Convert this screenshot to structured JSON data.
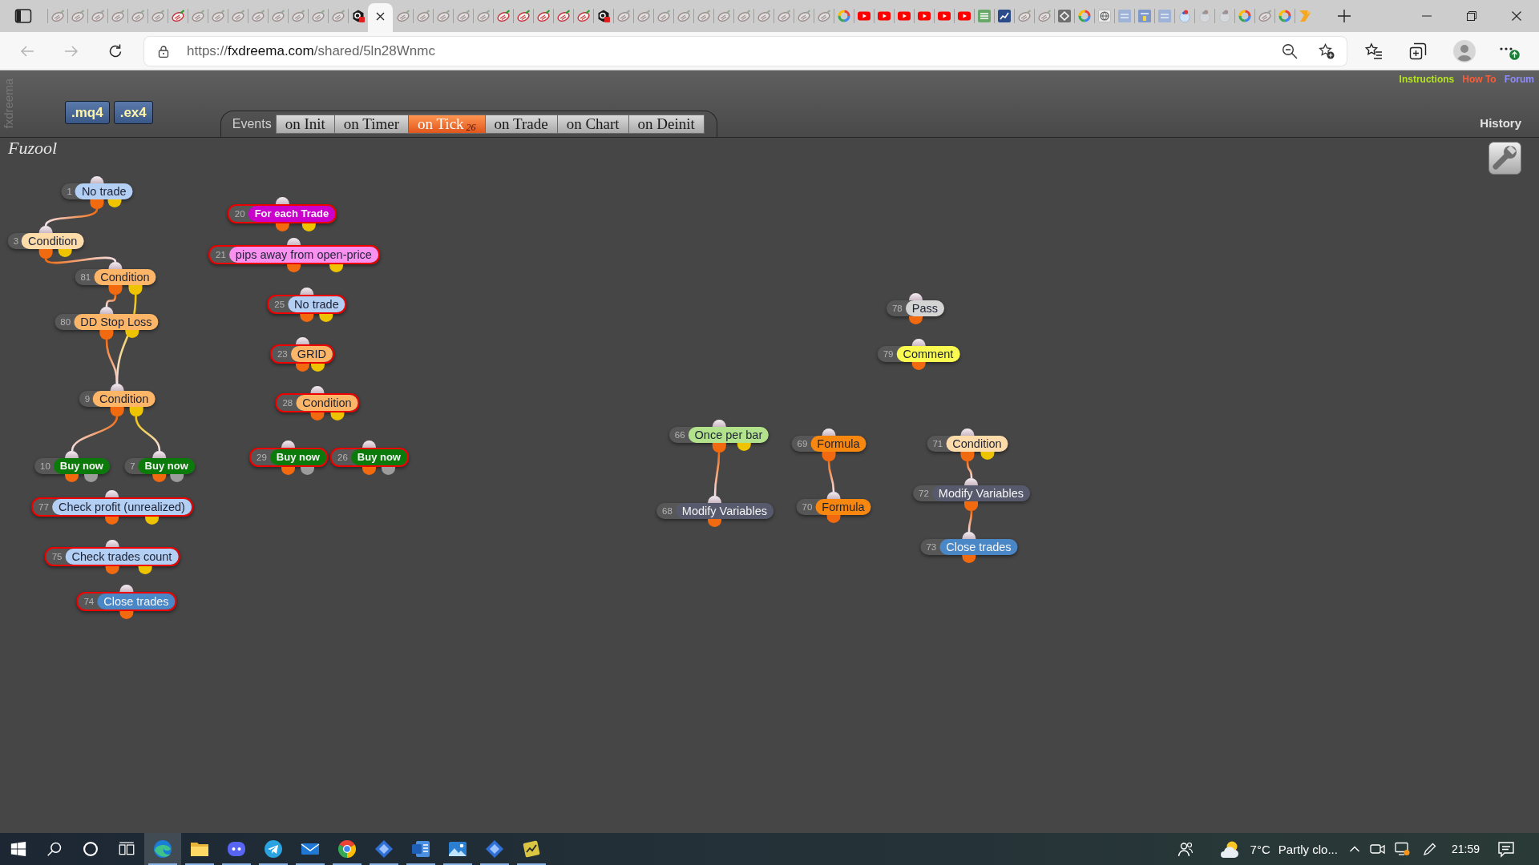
{
  "browser": {
    "tabs": [
      {
        "kind": "fxdreema",
        "sleeping": true,
        "selected": false
      },
      {
        "kind": "fxdreema",
        "sleeping": true,
        "selected": false
      },
      {
        "kind": "fxdreema",
        "sleeping": true,
        "selected": false
      },
      {
        "kind": "fxdreema",
        "sleeping": true,
        "selected": false
      },
      {
        "kind": "fxdreema",
        "sleeping": true,
        "selected": false
      },
      {
        "kind": "fxdreema",
        "sleeping": true,
        "selected": false
      },
      {
        "kind": "fxdreema",
        "sleeping": false,
        "selected": false
      },
      {
        "kind": "fxdreema",
        "sleeping": true,
        "selected": false
      },
      {
        "kind": "fxdreema",
        "sleeping": true,
        "selected": false
      },
      {
        "kind": "fxdreema",
        "sleeping": true,
        "selected": false
      },
      {
        "kind": "fxdreema",
        "sleeping": true,
        "selected": false
      },
      {
        "kind": "fxdreema",
        "sleeping": true,
        "selected": false
      },
      {
        "kind": "fxdreema",
        "sleeping": true,
        "selected": false
      },
      {
        "kind": "fxdreema",
        "sleeping": true,
        "selected": false
      },
      {
        "kind": "fxdreema",
        "sleeping": true,
        "selected": false
      },
      {
        "kind": "hexagon",
        "sleeping": false,
        "selected": false
      },
      {
        "sleeping": false,
        "selected": true
      },
      {
        "kind": "fxdreema",
        "sleeping": true,
        "selected": false
      },
      {
        "kind": "fxdreema",
        "sleeping": true,
        "selected": false
      },
      {
        "kind": "fxdreema",
        "sleeping": true,
        "selected": false
      },
      {
        "kind": "fxdreema",
        "sleeping": true,
        "selected": false
      },
      {
        "kind": "fxdreema",
        "sleeping": true,
        "selected": false
      },
      {
        "kind": "fxdreema",
        "sleeping": false,
        "selected": false
      },
      {
        "kind": "fxdreema",
        "sleeping": false,
        "selected": false
      },
      {
        "kind": "fxdreema",
        "sleeping": false,
        "selected": false
      },
      {
        "kind": "fxdreema",
        "sleeping": false,
        "selected": false
      },
      {
        "kind": "fxdreema",
        "sleeping": false,
        "selected": false
      },
      {
        "kind": "hexagon",
        "sleeping": false,
        "selected": false
      },
      {
        "kind": "fxdreema",
        "sleeping": true,
        "selected": false
      },
      {
        "kind": "fxdreema",
        "sleeping": true,
        "selected": false
      },
      {
        "kind": "fxdreema",
        "sleeping": true,
        "selected": false
      },
      {
        "kind": "fxdreema",
        "sleeping": true,
        "selected": false
      },
      {
        "kind": "fxdreema",
        "sleeping": true,
        "selected": false
      },
      {
        "kind": "fxdreema",
        "sleeping": true,
        "selected": false
      },
      {
        "kind": "fxdreema",
        "sleeping": true,
        "selected": false
      },
      {
        "kind": "fxdreema",
        "sleeping": true,
        "selected": false
      },
      {
        "kind": "fxdreema",
        "sleeping": true,
        "selected": false
      },
      {
        "kind": "fxdreema",
        "sleeping": true,
        "selected": false
      },
      {
        "kind": "fxdreema",
        "sleeping": true,
        "selected": false
      },
      {
        "kind": "google",
        "sleeping": false,
        "selected": false
      },
      {
        "kind": "youtube",
        "sleeping": false,
        "selected": false
      },
      {
        "kind": "youtube",
        "sleeping": false,
        "selected": false
      },
      {
        "kind": "youtube",
        "sleeping": false,
        "selected": false
      },
      {
        "kind": "youtube",
        "sleeping": false,
        "selected": false
      },
      {
        "kind": "youtube",
        "sleeping": false,
        "selected": false
      },
      {
        "kind": "youtube",
        "sleeping": false,
        "selected": false
      },
      {
        "kind": "bars_tile",
        "sleeping": false,
        "selected": false
      },
      {
        "kind": "chart_tile",
        "sleeping": false,
        "selected": false
      },
      {
        "kind": "fxdreema",
        "sleeping": true,
        "selected": false
      },
      {
        "kind": "fxdreema",
        "sleeping": true,
        "selected": false
      },
      {
        "kind": "diamond_tile",
        "sleeping": false,
        "selected": false
      },
      {
        "kind": "google",
        "sleeping": false,
        "selected": false
      },
      {
        "kind": "globe_tile",
        "sleeping": false,
        "selected": false
      },
      {
        "kind": "striped_tile",
        "sleeping": false,
        "selected": false
      },
      {
        "kind": "striped_tile_alt",
        "sleeping": false,
        "selected": false
      },
      {
        "kind": "striped_tile",
        "sleeping": false,
        "selected": false
      },
      {
        "kind": "orb",
        "sleeping": false,
        "selected": false
      },
      {
        "kind": "orb",
        "sleeping": true,
        "selected": false
      },
      {
        "kind": "orb",
        "sleeping": true,
        "selected": false
      },
      {
        "kind": "google",
        "sleeping": false,
        "selected": false
      },
      {
        "kind": "fxdreema",
        "sleeping": true,
        "selected": false
      },
      {
        "kind": "google",
        "sleeping": false,
        "selected": false
      },
      {
        "kind": "chevron",
        "sleeping": false,
        "selected": false
      }
    ],
    "back": {
      "disabled": true
    },
    "forward": {
      "disabled": true
    },
    "address_bar": {
      "scheme": "https://",
      "host": "fxdreema.com",
      "path": "/shared/5ln28Wnmc"
    }
  },
  "app": {
    "brand": "fxdreema",
    "export_buttons": [
      ".mq4",
      ".ex4"
    ],
    "events_label": "Events",
    "event_tabs": [
      {
        "label": "on Init",
        "selected": false
      },
      {
        "label": "on Timer",
        "selected": false
      },
      {
        "label": "on Tick",
        "count": "26",
        "selected": true
      },
      {
        "label": "on Trade",
        "selected": false
      },
      {
        "label": "on Chart",
        "selected": false
      },
      {
        "label": "on Deinit",
        "selected": false
      }
    ],
    "links": [
      {
        "label": "Instructions",
        "color": "#b5e61d"
      },
      {
        "label": "How To",
        "color": "#ff5a36"
      },
      {
        "label": "Forum",
        "color": "#8f8cff"
      }
    ],
    "history": "History",
    "project_name": "Fuzool",
    "blocks": [
      {
        "number": "1",
        "label": "No trade",
        "color": "#b4cff4",
        "kind": "plain",
        "selected": false,
        "outputs": [
          {
            "color": "#f26a10",
            "wired": true
          },
          {
            "color": "#eec400",
            "wired": false
          }
        ]
      },
      {
        "number": "3",
        "label": "Condition",
        "color": "#fddcaa",
        "kind": "plain",
        "selected": false,
        "outputs": [
          {
            "color": "#f26a10",
            "wired": true
          },
          {
            "color": "#eec400",
            "wired": false
          }
        ]
      },
      {
        "number": "81",
        "label": "Condition",
        "color": "#fdb568",
        "kind": "plain",
        "selected": false,
        "outputs": [
          {
            "color": "#f26a10",
            "wired": true
          },
          {
            "color": "#eec400",
            "wired": true
          }
        ]
      },
      {
        "number": "80",
        "label": "DD Stop Loss",
        "color": "#fdb568",
        "kind": "plain",
        "selected": false,
        "outputs": [
          {
            "color": "#f26a10",
            "wired": true
          },
          {
            "color": "#eec400",
            "wired": false
          }
        ]
      },
      {
        "number": "9",
        "label": "Condition",
        "color": "#fdb568",
        "kind": "plain",
        "selected": false,
        "outputs": [
          {
            "color": "#f26a10",
            "wired": true
          },
          {
            "color": "#eec400",
            "wired": true
          }
        ]
      },
      {
        "number": "10",
        "label": "Buy now",
        "color": "#0b7a0b",
        "kind": "strong",
        "selected": false,
        "outputs": [
          {
            "color": "#f26a10",
            "wired": false
          },
          {
            "color": "#9c9c9c",
            "wired": false
          }
        ]
      },
      {
        "number": "7",
        "label": "Buy now",
        "color": "#0b7a0b",
        "kind": "strong",
        "selected": false,
        "outputs": [
          {
            "color": "#f26a10",
            "wired": false
          },
          {
            "color": "#9c9c9c",
            "wired": false
          }
        ]
      },
      {
        "number": "77",
        "label": "Check profit (unrealized)",
        "color": "#b4cff4",
        "kind": "plain",
        "selected": true,
        "outputs": [
          {
            "color": "#f26a10",
            "wired": false
          },
          {
            "color": "#eec400",
            "wired": false
          }
        ]
      },
      {
        "number": "75",
        "label": "Check trades count",
        "color": "#b4cff4",
        "kind": "plain",
        "selected": true,
        "outputs": [
          {
            "color": "#f26a10",
            "wired": false
          },
          {
            "color": "#eec400",
            "wired": false
          }
        ]
      },
      {
        "number": "74",
        "label": "Close trades",
        "color": "#4a87c6",
        "kind": "plain",
        "selected": true,
        "outputs": [
          {
            "color": "#f26a10",
            "wired": false
          }
        ]
      },
      {
        "number": "20",
        "label": "For each Trade",
        "color": "#cc00cc",
        "kind": "strong",
        "selected": true,
        "outputs": [
          {
            "color": "#f26a10",
            "wired": false
          },
          {
            "color": "#eec400",
            "wired": false
          }
        ]
      },
      {
        "number": "21",
        "label": "pips away from open-price",
        "color": "#fa90f0",
        "kind": "plain",
        "selected": true,
        "outputs": [
          {
            "color": "#f26a10",
            "wired": false
          },
          {
            "color": "#eec400",
            "wired": false
          }
        ]
      },
      {
        "number": "25",
        "label": "No trade",
        "color": "#b4cff4",
        "kind": "plain",
        "selected": true,
        "outputs": [
          {
            "color": "#f26a10",
            "wired": false
          },
          {
            "color": "#eec400",
            "wired": false
          }
        ]
      },
      {
        "number": "23",
        "label": "GRID",
        "color": "#fdb568",
        "kind": "plain",
        "selected": true,
        "outputs": [
          {
            "color": "#f26a10",
            "wired": false
          },
          {
            "color": "#eec400",
            "wired": false
          }
        ]
      },
      {
        "number": "28",
        "label": "Condition",
        "color": "#fdb568",
        "kind": "plain",
        "selected": true,
        "outputs": [
          {
            "color": "#f26a10",
            "wired": false
          },
          {
            "color": "#eec400",
            "wired": false
          }
        ]
      },
      {
        "number": "29",
        "label": "Buy now",
        "color": "#0b7a0b",
        "kind": "strong",
        "selected": true,
        "outputs": [
          {
            "color": "#f26a10",
            "wired": false
          },
          {
            "color": "#9c9c9c",
            "wired": false
          }
        ]
      },
      {
        "number": "26",
        "label": "Buy now",
        "color": "#0b7a0b",
        "kind": "strong",
        "selected": true,
        "outputs": [
          {
            "color": "#f26a10",
            "wired": false
          },
          {
            "color": "#9c9c9c",
            "wired": false
          }
        ]
      },
      {
        "number": "78",
        "label": "Pass",
        "color": "#d4d4d4",
        "kind": "plain",
        "selected": false,
        "outputs": [
          {
            "color": "#f26a10",
            "wired": false
          }
        ]
      },
      {
        "number": "79",
        "label": "Comment",
        "color": "#fafa50",
        "kind": "plain",
        "selected": false,
        "outputs": [
          {
            "color": "#f26a10",
            "wired": false
          }
        ]
      },
      {
        "number": "66",
        "label": "Once per bar",
        "color": "#b2e38c",
        "kind": "plain",
        "selected": false,
        "outputs": [
          {
            "color": "#f26a10",
            "wired": true
          },
          {
            "color": "#eec400",
            "wired": false
          }
        ]
      },
      {
        "number": "68",
        "label": "Modify Variables",
        "color": "#565a6c",
        "kind": "plain",
        "selected": false,
        "outputs": [
          {
            "color": "#f26a10",
            "wired": false
          }
        ]
      },
      {
        "number": "69",
        "label": "Formula",
        "color": "#f7870f",
        "kind": "plain",
        "selected": false,
        "outputs": [
          {
            "color": "#f26a10",
            "wired": true
          }
        ]
      },
      {
        "number": "70",
        "label": "Formula",
        "color": "#f7870f",
        "kind": "plain",
        "selected": false,
        "outputs": [
          {
            "color": "#f26a10",
            "wired": false
          }
        ]
      },
      {
        "number": "71",
        "label": "Condition",
        "color": "#fddcaa",
        "kind": "plain",
        "selected": false,
        "outputs": [
          {
            "color": "#f26a10",
            "wired": true
          },
          {
            "color": "#eec400",
            "wired": false
          }
        ]
      },
      {
        "number": "72",
        "label": "Modify Variables",
        "color": "#565a6c",
        "kind": "plain",
        "selected": false,
        "outputs": [
          {
            "color": "#f26a10",
            "wired": true
          }
        ]
      },
      {
        "number": "73",
        "label": "Close trades",
        "color": "#4a87c6",
        "kind": "plain",
        "selected": false,
        "outputs": [
          {
            "color": "#f26a10",
            "wired": false
          }
        ]
      }
    ]
  },
  "taskbar": {
    "apps": [
      {
        "kind": "edge",
        "selected": true,
        "running": true
      },
      {
        "kind": "explorer",
        "selected": false,
        "running": true
      },
      {
        "kind": "discord",
        "selected": false,
        "running": true
      },
      {
        "kind": "telegram",
        "selected": false,
        "running": true
      },
      {
        "kind": "mail",
        "selected": false,
        "running": true
      },
      {
        "kind": "chrome",
        "selected": false,
        "running": true
      },
      {
        "kind": "diamond",
        "selected": false,
        "running": true
      },
      {
        "kind": "word",
        "selected": false,
        "running": true
      },
      {
        "kind": "photos",
        "selected": false,
        "running": true
      },
      {
        "kind": "diamond",
        "selected": false,
        "running": true
      },
      {
        "kind": "chart_tile",
        "selected": false,
        "running": true
      }
    ],
    "weather": {
      "temperature": "7°C",
      "condition": "Partly clo..."
    },
    "time": "21:59"
  }
}
